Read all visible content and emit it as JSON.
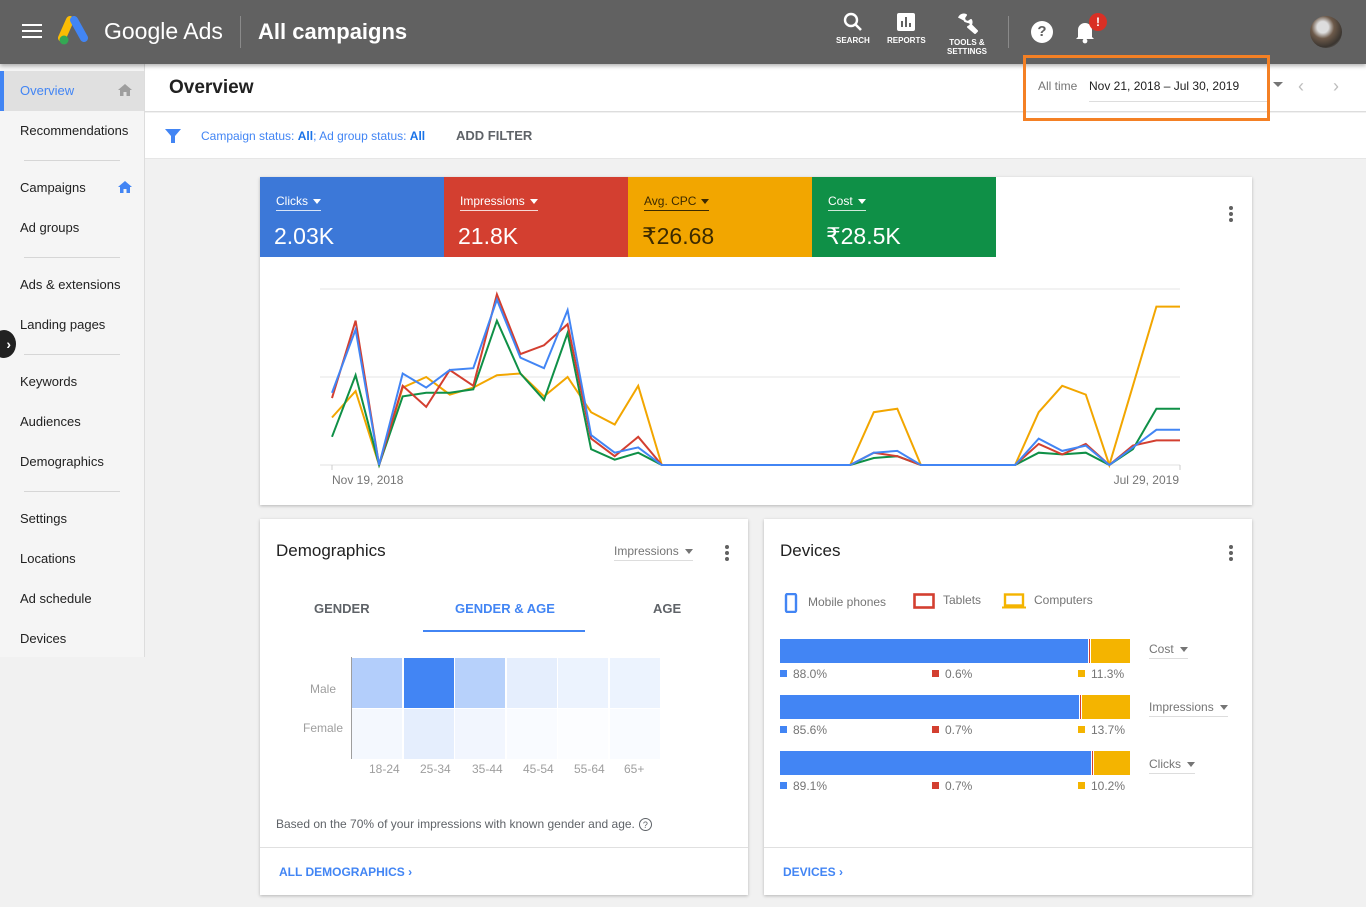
{
  "topbar": {
    "brand": "Google Ads",
    "page_title": "All campaigns",
    "tools": [
      {
        "label": "SEARCH",
        "icon": "search-icon"
      },
      {
        "label": "REPORTS",
        "icon": "reports-icon"
      },
      {
        "label": "TOOLS &",
        "label2": "SETTINGS",
        "icon": "wrench-icon"
      }
    ],
    "help_glyph": "?",
    "notification_badge": "!"
  },
  "sidebar": {
    "items": [
      {
        "label": "Overview",
        "active": true,
        "home": true
      },
      {
        "label": "Recommendations"
      },
      {
        "label": "Campaigns",
        "home": true
      },
      {
        "label": "Ad groups"
      },
      {
        "label": "Ads & extensions"
      },
      {
        "label": "Landing pages"
      },
      {
        "label": "Keywords"
      },
      {
        "label": "Audiences"
      },
      {
        "label": "Demographics"
      },
      {
        "label": "Settings"
      },
      {
        "label": "Locations"
      },
      {
        "label": "Ad schedule"
      },
      {
        "label": "Devices"
      }
    ],
    "expand_glyph": "›"
  },
  "header": {
    "title": "Overview",
    "date_label": "All time",
    "date_range": "Nov 21, 2018 – Jul 30, 2019",
    "prev_glyph": "‹",
    "next_glyph": "›"
  },
  "filter": {
    "campaign_label": "Campaign status: ",
    "campaign_value": "All",
    "separator": "; Ad group status: ",
    "adgroup_value": "All",
    "add_filter": "ADD FILTER"
  },
  "kpis": [
    {
      "name": "Clicks",
      "value": "2.03K",
      "color": "#3c78d8"
    },
    {
      "name": "Impressions",
      "value": "21.8K",
      "color": "#d33f30"
    },
    {
      "name": "Avg. CPC",
      "value": "₹26.68",
      "color": "#f2a600"
    },
    {
      "name": "Cost",
      "value": "₹28.5K",
      "color": "#0f9047"
    }
  ],
  "chart_data": {
    "type": "line",
    "title": "",
    "x_start_label": "Nov 19, 2018",
    "x_end_label": "Jul 29, 2019",
    "ylim": [
      0,
      1
    ],
    "grid": true,
    "note": "values normalized to chart height (no y-axis labels shown)",
    "series": [
      {
        "name": "Clicks",
        "color": "#4285f4",
        "values": [
          0.41,
          0.77,
          0,
          0.52,
          0.44,
          0.54,
          0.55,
          0.94,
          0.61,
          0.55,
          0.88,
          0.17,
          0.07,
          0.1,
          0,
          0,
          0,
          0,
          0,
          0,
          0,
          0,
          0,
          0.07,
          0.08,
          0,
          0,
          0,
          0,
          0,
          0.15,
          0.08,
          0.11,
          0,
          0.1,
          0.2,
          0.2
        ]
      },
      {
        "name": "Impressions",
        "color": "#d33f30",
        "values": [
          0.38,
          0.82,
          0,
          0.45,
          0.33,
          0.54,
          0.45,
          0.97,
          0.63,
          0.68,
          0.8,
          0.15,
          0.05,
          0.16,
          0,
          0,
          0,
          0,
          0,
          0,
          0,
          0,
          0,
          0.07,
          0.05,
          0,
          0,
          0,
          0,
          0,
          0.12,
          0.06,
          0.12,
          0,
          0.11,
          0.14,
          0.14
        ]
      },
      {
        "name": "Avg. CPC",
        "color": "#f2a600",
        "values": [
          0.27,
          0.42,
          0,
          0.44,
          0.5,
          0.4,
          0.44,
          0.51,
          0.52,
          0.39,
          0.5,
          0.3,
          0.23,
          0.45,
          0,
          0,
          0,
          0,
          0,
          0,
          0,
          0,
          0,
          0.3,
          0.32,
          0,
          0,
          0,
          0,
          0,
          0.3,
          0.45,
          0.4,
          0,
          0.45,
          0.9,
          0.9
        ]
      },
      {
        "name": "Cost",
        "color": "#0f9047",
        "values": [
          0.16,
          0.51,
          0,
          0.39,
          0.41,
          0.41,
          0.43,
          0.82,
          0.52,
          0.37,
          0.75,
          0.09,
          0.03,
          0.07,
          0,
          0,
          0,
          0,
          0,
          0,
          0,
          0,
          0,
          0.04,
          0.05,
          0,
          0,
          0,
          0,
          0,
          0.07,
          0.06,
          0.07,
          0,
          0.09,
          0.32,
          0.32
        ]
      }
    ]
  },
  "demographics": {
    "title": "Demographics",
    "metric": "Impressions",
    "tabs": [
      {
        "label": "GENDER",
        "active": false
      },
      {
        "label": "GENDER & AGE",
        "active": true
      },
      {
        "label": "AGE",
        "active": false
      }
    ],
    "heatmap": {
      "type": "heatmap",
      "rows": [
        "Male",
        "Female"
      ],
      "columns": [
        "18-24",
        "25-34",
        "35-44",
        "45-54",
        "55-64",
        "65+"
      ],
      "intensity": [
        [
          0.4,
          1.0,
          0.38,
          0.14,
          0.1,
          0.1
        ],
        [
          0.06,
          0.14,
          0.07,
          0.03,
          0.0,
          0.03
        ]
      ]
    },
    "footnote": "Based on the 70% of your impressions with known gender and age.",
    "link": "ALL DEMOGRAPHICS"
  },
  "devices": {
    "title": "Devices",
    "legend": [
      {
        "label": "Mobile phones",
        "color": "#4285f4"
      },
      {
        "label": "Tablets",
        "color": "#d33f30"
      },
      {
        "label": "Computers",
        "color": "#f4b400"
      }
    ],
    "rows": [
      {
        "metric": "Cost",
        "mobile": "88.0%",
        "tablet": "0.6%",
        "computer": "11.3%",
        "mobile_v": 88.0,
        "tablet_v": 0.6,
        "computer_v": 11.3
      },
      {
        "metric": "Impressions",
        "mobile": "85.6%",
        "tablet": "0.7%",
        "computer": "13.7%",
        "mobile_v": 85.6,
        "tablet_v": 0.7,
        "computer_v": 13.7
      },
      {
        "metric": "Clicks",
        "mobile": "89.1%",
        "tablet": "0.7%",
        "computer": "10.2%",
        "mobile_v": 89.1,
        "tablet_v": 0.7,
        "computer_v": 10.2
      }
    ],
    "link": "DEVICES"
  }
}
